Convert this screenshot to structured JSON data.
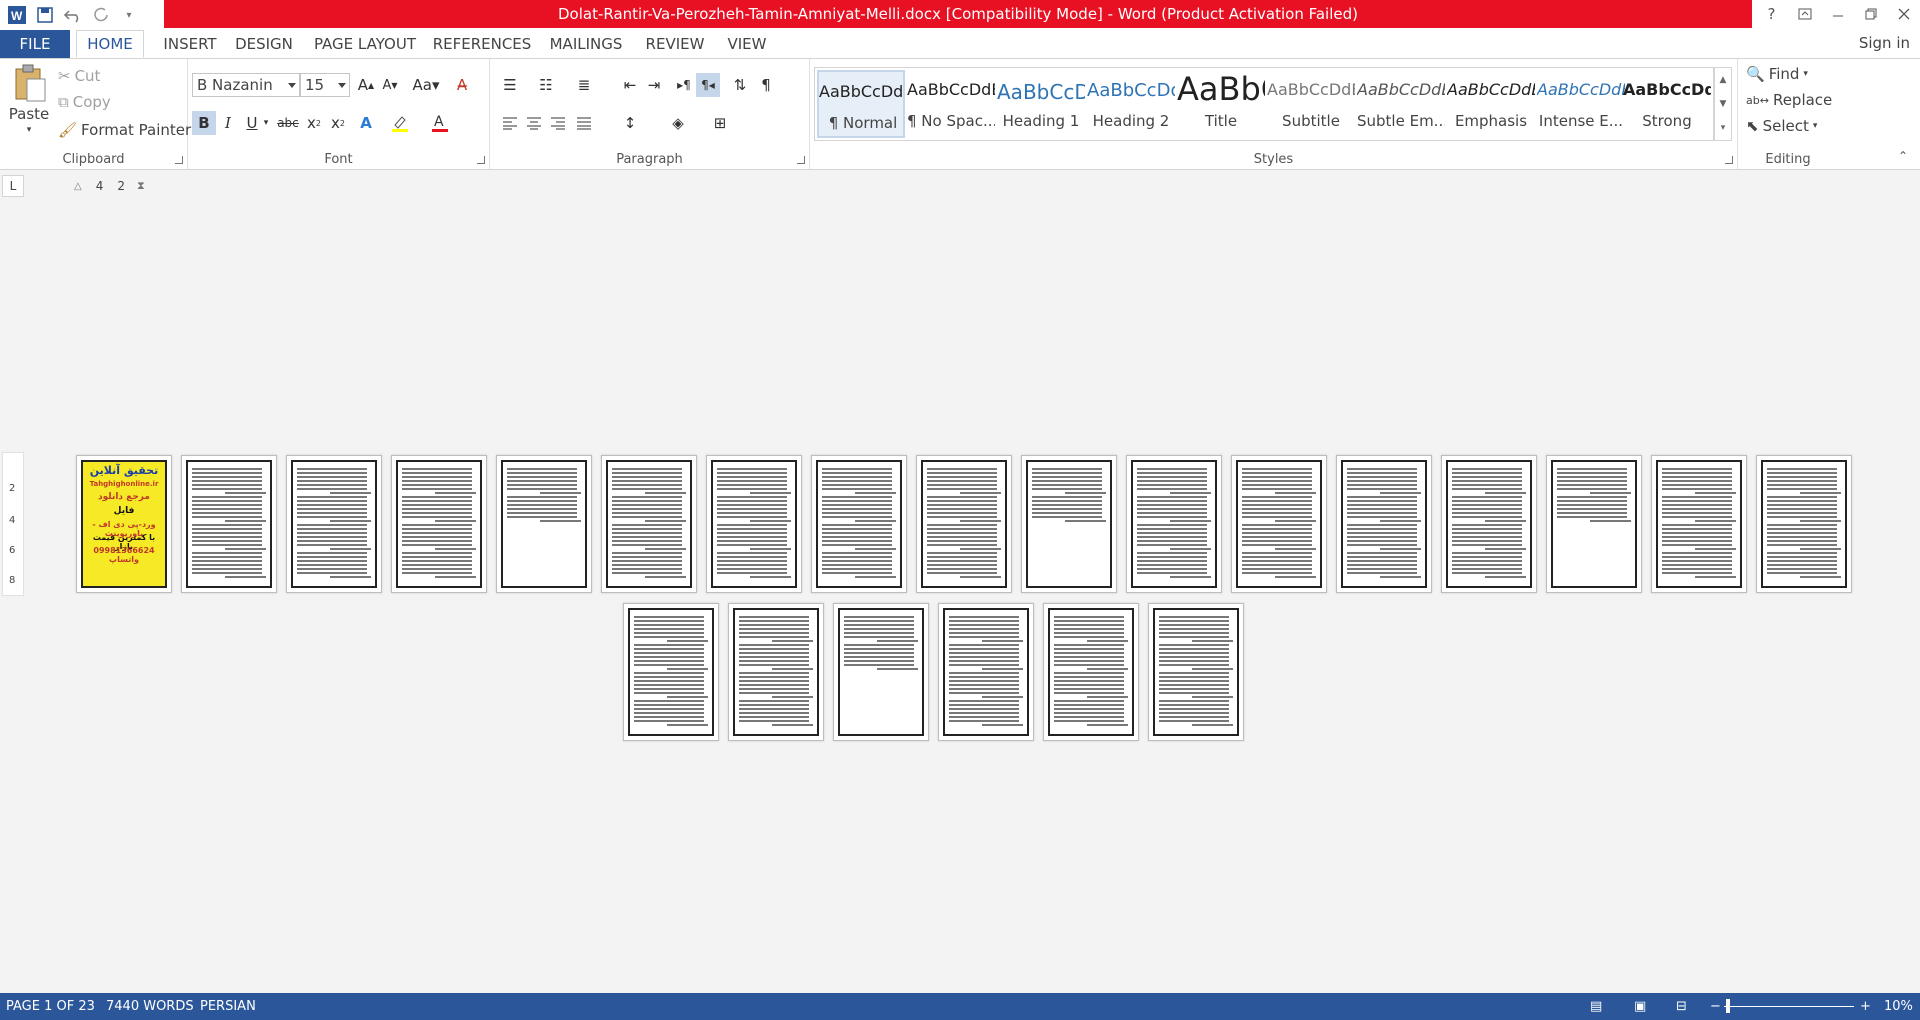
{
  "titlebar": {
    "title": "Dolat-Rantir-Va-Perozheh-Tamin-Amniyat-Melli.docx [Compatibility Mode] -  Word (Product Activation Failed)",
    "help": "?",
    "sign_in": "Sign in"
  },
  "tabs": [
    "FILE",
    "HOME",
    "INSERT",
    "DESIGN",
    "PAGE LAYOUT",
    "REFERENCES",
    "MAILINGS",
    "REVIEW",
    "VIEW"
  ],
  "clipboard": {
    "label": "Clipboard",
    "paste": "Paste",
    "cut": "Cut",
    "copy": "Copy",
    "format_painter": "Format Painter"
  },
  "font": {
    "label": "Font",
    "name": "B Nazanin",
    "size": "15"
  },
  "paragraph": {
    "label": "Paragraph"
  },
  "styles": {
    "label": "Styles",
    "items": [
      {
        "preview": "AaBbCcDdEe",
        "name": "¶ Normal"
      },
      {
        "preview": "AaBbCcDdEe",
        "name": "¶ No Spac..."
      },
      {
        "preview": "AaBbCcDdEe",
        "name": "Heading 1"
      },
      {
        "preview": "AaBbCcDdEe",
        "name": "Heading 2"
      },
      {
        "preview": "AaBbCcDdEe",
        "name": "Title"
      },
      {
        "preview": "AaBbCcDdEe",
        "name": "Subtitle"
      },
      {
        "preview": "AaBbCcDdEe",
        "name": "Subtle Em..."
      },
      {
        "preview": "AaBbCcDdEe",
        "name": "Emphasis"
      },
      {
        "preview": "AaBbCcDdEe",
        "name": "Intense E..."
      },
      {
        "preview": "AaBbCcDdEe",
        "name": "Strong"
      }
    ]
  },
  "editing": {
    "label": "Editing",
    "find": "Find",
    "replace": "Replace",
    "select": "Select"
  },
  "ruler": {
    "marks": [
      "4",
      "2"
    ],
    "vmarks": [
      "2",
      "4",
      "6",
      "8"
    ]
  },
  "ad_page": {
    "lines": [
      "تحقیق آنلاین",
      "Tahghighonline.ir",
      "مرجع دانلود",
      "فایل",
      "ورد-پی دی اف - پاورپوینت",
      "با کمترین قیمت بازار",
      "09981366624 واتساپ"
    ]
  },
  "status": {
    "page": "PAGE 1 OF 23",
    "words": "7440 WORDS",
    "language": "PERSIAN",
    "zoom": "10%"
  },
  "document": {
    "page_count": 23
  }
}
